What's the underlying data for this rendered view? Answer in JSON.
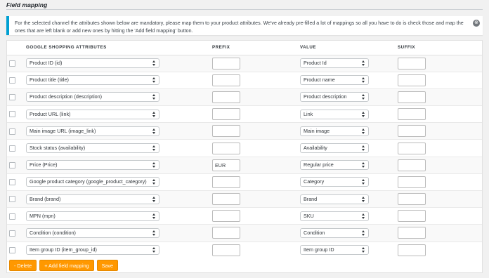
{
  "header": {
    "title": "Field mapping"
  },
  "notice": {
    "text": "For the selected channel the attributes shown below are mandatory, please map them to your product attributes. We've already pre-filled a lot of mappings so all you have to do is check those and map the ones that are left blank or add new ones by hitting the 'Add field mapping' button.",
    "close_icon": "⊗"
  },
  "table": {
    "headers": {
      "attribute": "GOOGLE SHOPPING ATTRIBUTES",
      "prefix": "PREFIX",
      "value": "VALUE",
      "suffix": "SUFFIX"
    },
    "rows": [
      {
        "attribute": "Product ID (id)",
        "prefix": "",
        "value": "Product Id",
        "suffix": ""
      },
      {
        "attribute": "Product title (title)",
        "prefix": "",
        "value": "Product name",
        "suffix": ""
      },
      {
        "attribute": "Product description (description)",
        "prefix": "",
        "value": "Product description",
        "suffix": ""
      },
      {
        "attribute": "Product URL (link)",
        "prefix": "",
        "value": "Link",
        "suffix": ""
      },
      {
        "attribute": "Main image URL (image_link)",
        "prefix": "",
        "value": "Main image",
        "suffix": ""
      },
      {
        "attribute": "Stock status (availability)",
        "prefix": "",
        "value": "Availability",
        "suffix": ""
      },
      {
        "attribute": "Price (Price)",
        "prefix": "EUR",
        "value": "Regular price",
        "suffix": ""
      },
      {
        "attribute": "Google product category (google_product_category)",
        "prefix": "",
        "value": "Category",
        "suffix": ""
      },
      {
        "attribute": "Brand (brand)",
        "prefix": "",
        "value": "Brand",
        "suffix": ""
      },
      {
        "attribute": "MPN (mpn)",
        "prefix": "",
        "value": "SKU",
        "suffix": ""
      },
      {
        "attribute": "Condition (condition)",
        "prefix": "",
        "value": "Condition",
        "suffix": ""
      },
      {
        "attribute": "Item group ID (item_group_id)",
        "prefix": "",
        "value": "Item group ID",
        "suffix": ""
      }
    ]
  },
  "buttons": {
    "delete": "- Delete",
    "add": "+ Add field mapping",
    "save": "Save"
  },
  "colors": {
    "accent": "#ff9800",
    "notice_border": "#00a0d2"
  }
}
